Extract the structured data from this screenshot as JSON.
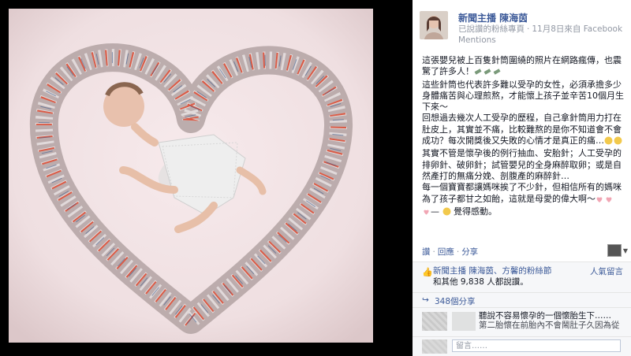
{
  "post": {
    "author": "新聞主播 陳海茵",
    "meta_left": "已說讚的粉絲專頁",
    "meta_date": "11月8日來自 Facebook",
    "meta_source": "Mentions",
    "para1": "這張嬰兒被上百隻針筒圍繞的照片在網路瘋傳，也震驚了許多人！",
    "para2": "這些針筒也代表許多難以受孕的女性，必須承擔多少身體痛苦與心理煎熬，才能懷上孩子並辛苦10個月生下來～",
    "para3": "回想過去幾次人工受孕的歷程，自己拿針筒用力打在肚皮上，其實並不痛，比較難熬的是你不知道會不會成功？每次開獎後又失敗的心情才是真正的痛…",
    "para4": "其實不管是懷孕後的例行抽血、安胎針；人工受孕的排卵針、破卵針；試管嬰兒的全身麻醉取卵；或是自然產打的無痛分娩、剖腹產的麻醉針…",
    "para5": "每一個寶寶都讓媽咪挨了不少針，但相信所有的媽咪為了孩子都甘之如飴，這就是母愛的偉大啊～",
    "para5_tail": "—",
    "para5_end": "覺得感動。"
  },
  "actions": {
    "like": "讚",
    "comment": "回應",
    "share": "分享"
  },
  "likes": {
    "prefix_link": "新聞主播 陳海茵、方馨的粉絲節",
    "suffix": "和其他 9,838 人都說讚。",
    "sort": "人氣留言"
  },
  "shares": {
    "label": "348個分享"
  },
  "comment": {
    "text1": "聽說不容易懷孕的一個懷胎生下……",
    "text2": "第二胎懷在前胎內不會鬧肚子久因為從"
  },
  "reply": {
    "placeholder": "留言……"
  },
  "colors": {
    "link": "#3b5998",
    "muted": "#9197a3",
    "panel_bg": "#f6f7f9",
    "backdrop": "#000000"
  },
  "icons": [
    "syringe-emoji",
    "crying-emoji",
    "heart-emoji",
    "smile-emoji",
    "thumbs-up-icon",
    "share-icon"
  ]
}
